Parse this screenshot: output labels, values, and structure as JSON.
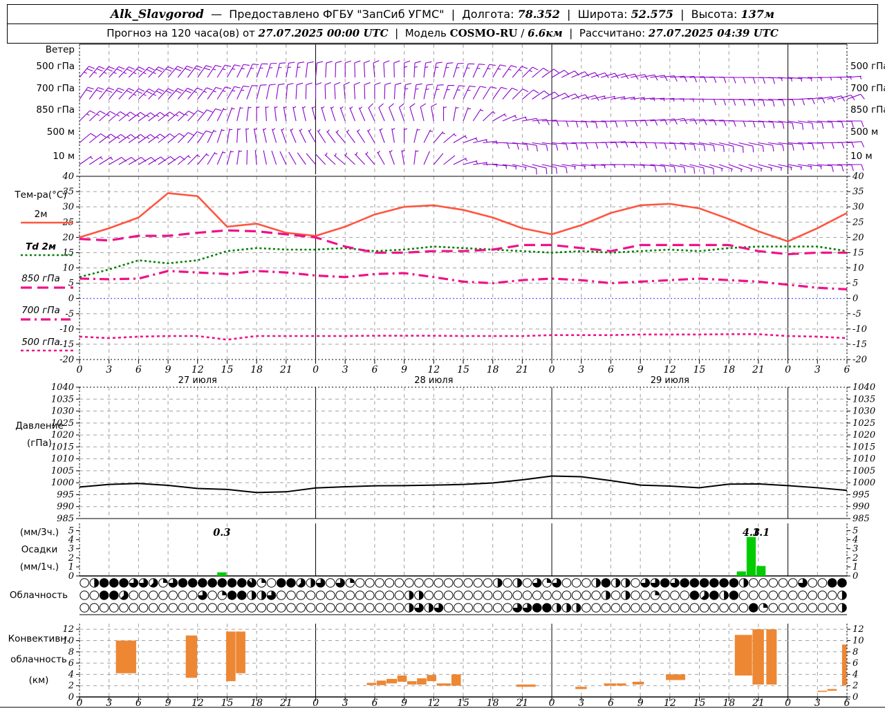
{
  "header": {
    "station": "Alk_Slavgorod",
    "dash": "—",
    "provider": "Предоставлено ФГБУ \"ЗапСиб УГМС\"",
    "sep": "|",
    "lon_label": "Долгота:",
    "lon": "78.352",
    "lat_label": "Широта:",
    "lat": "52.575",
    "alt_label": "Высота:",
    "alt": "137м",
    "forecast_label": "Прогноз на 120 часа(ов) от",
    "forecast_start": "27.07.2025 00:00 UTC",
    "model_label": "Модель",
    "model_name": "COSMO-RU",
    "model_slash": "/",
    "model_res": "6.6км",
    "calc_label": "Рассчитано:",
    "calc_time": "27.07.2025 04:39 UTC"
  },
  "labels": {
    "wind_title": "Ветер",
    "temp_title": "Тем-ра(°C)",
    "pressure_1": "Давление",
    "pressure_2": "(гПа)",
    "precip_1": "(мм/3ч.)",
    "precip_2": "Осадки",
    "precip_3": "(мм/1ч.)",
    "cloud_title": "Облачность",
    "conv_1": "Конвективн.",
    "conv_2": "облачность",
    "conv_3": "(км)"
  },
  "colors": {
    "barb": "#8800CC",
    "t2m": "#FF5540",
    "td2m": "#008000",
    "magenta": "#EE1289",
    "zero_line": "#4444FF",
    "pressure": "#000000",
    "precip": "#00CC00",
    "conv": "#ED8733",
    "grid": "#A0A0A0"
  },
  "chart_data": [
    {
      "type": "wind-barbs",
      "title": "Ветер",
      "levels": [
        "500 гПа",
        "700 гПа",
        "850 гПа",
        "500 м",
        "10 м"
      ],
      "hours_step": 3,
      "series": [
        {
          "name": "500 гПа",
          "dir": [
            40,
            42,
            45,
            40,
            35,
            30,
            20,
            10,
            5,
            0,
            -5,
            0,
            10,
            20,
            30,
            45,
            60,
            70,
            75,
            80,
            85,
            88,
            90,
            92,
            95,
            90,
            85
          ],
          "spd": [
            25,
            25,
            25,
            22,
            20,
            18,
            15,
            15,
            12,
            12,
            12,
            15,
            18,
            18,
            15,
            15,
            12,
            10,
            10,
            10,
            10,
            12,
            12,
            10,
            8,
            8,
            8
          ]
        },
        {
          "name": "700 гПа",
          "dir": [
            35,
            40,
            45,
            42,
            38,
            30,
            15,
            5,
            0,
            -5,
            0,
            5,
            15,
            25,
            35,
            50,
            65,
            75,
            80,
            85,
            88,
            90,
            92,
            95,
            90,
            80,
            70
          ],
          "spd": [
            20,
            22,
            25,
            22,
            18,
            15,
            12,
            10,
            10,
            10,
            12,
            15,
            15,
            15,
            12,
            12,
            10,
            10,
            8,
            8,
            8,
            10,
            10,
            10,
            10,
            12,
            12
          ]
        },
        {
          "name": "850 гПа",
          "dir": [
            45,
            50,
            55,
            50,
            40,
            20,
            0,
            -10,
            -15,
            -20,
            -25,
            -20,
            -10,
            20,
            60,
            80,
            90,
            95,
            90,
            85,
            80,
            85,
            90,
            95,
            100,
            95,
            90
          ],
          "spd": [
            15,
            18,
            18,
            15,
            12,
            8,
            5,
            5,
            5,
            8,
            10,
            12,
            10,
            8,
            8,
            10,
            12,
            12,
            10,
            10,
            10,
            12,
            12,
            10,
            10,
            12,
            12
          ]
        },
        {
          "name": "500 м",
          "dir": [
            50,
            55,
            55,
            50,
            35,
            10,
            -10,
            -20,
            -30,
            -40,
            -30,
            0,
            40,
            70,
            90,
            100,
            95,
            90,
            85,
            90,
            95,
            100,
            105,
            100,
            95,
            90,
            85
          ],
          "spd": [
            12,
            15,
            15,
            12,
            10,
            5,
            5,
            5,
            5,
            8,
            8,
            8,
            5,
            8,
            10,
            12,
            12,
            10,
            10,
            12,
            12,
            12,
            10,
            10,
            10,
            12,
            12
          ]
        },
        {
          "name": "10 м",
          "dir": [
            55,
            60,
            60,
            55,
            40,
            15,
            -5,
            -25,
            -40,
            -50,
            -40,
            -10,
            40,
            75,
            95,
            105,
            100,
            95,
            90,
            95,
            100,
            105,
            110,
            105,
            100,
            95,
            90
          ],
          "spd": [
            8,
            10,
            10,
            10,
            8,
            5,
            3,
            3,
            3,
            5,
            5,
            5,
            3,
            5,
            8,
            10,
            10,
            8,
            8,
            10,
            10,
            10,
            8,
            8,
            8,
            10,
            10
          ]
        }
      ]
    },
    {
      "type": "line",
      "title": "Тем-ра(°C)",
      "ylim": [
        -20,
        40
      ],
      "yticks": [
        40,
        35,
        30,
        25,
        20,
        15,
        10,
        5,
        0,
        -5,
        -10,
        -15,
        -20
      ],
      "hours_step": 3,
      "legend": [
        {
          "key": "t2m",
          "label": "2м"
        },
        {
          "key": "td2m",
          "label": "Td  2м"
        },
        {
          "key": "t850",
          "label": "850 гПа"
        },
        {
          "key": "t700",
          "label": "700 гПа"
        },
        {
          "key": "t500",
          "label": "500 гПа"
        }
      ],
      "series": [
        {
          "key": "t2m",
          "values": [
            20,
            23,
            26.5,
            34.5,
            33.5,
            23.5,
            24.5,
            21.5,
            20.5,
            23.5,
            27.5,
            30,
            30.5,
            29,
            26.5,
            23,
            21,
            24,
            28,
            30.5,
            31,
            29.5,
            26,
            22,
            18.7,
            23,
            28
          ]
        },
        {
          "key": "td2m",
          "values": [
            7,
            9.5,
            12.5,
            11.5,
            12.5,
            15.5,
            16.5,
            16,
            16,
            16.5,
            15.5,
            16,
            17,
            16.5,
            16,
            15.5,
            15,
            15.5,
            15,
            15.5,
            16,
            15.5,
            16.5,
            17,
            17,
            17,
            15.5
          ]
        },
        {
          "key": "t850",
          "values": [
            19.5,
            19,
            20.5,
            20.5,
            21.5,
            22.3,
            22,
            21,
            20,
            17,
            15,
            15,
            15.5,
            15.5,
            16,
            17.5,
            17.5,
            16.5,
            15.5,
            17.5,
            17.5,
            17.5,
            17.5,
            15.5,
            14.5,
            15,
            15
          ]
        },
        {
          "key": "t700",
          "values": [
            6.5,
            6.3,
            6.5,
            9,
            8.5,
            8,
            9,
            8.5,
            7.5,
            7,
            8,
            8.3,
            7,
            5.5,
            5,
            6,
            6.5,
            6,
            5,
            5.5,
            6,
            6.5,
            6,
            5.5,
            4.5,
            3.5,
            3
          ]
        },
        {
          "key": "t500",
          "values": [
            -12.5,
            -13,
            -12.5,
            -12.3,
            -12.3,
            -13.5,
            -12.3,
            -12.3,
            -12.3,
            -12.3,
            -12.2,
            -12.2,
            -12.2,
            -12.3,
            -12.3,
            -12.3,
            -12,
            -12,
            -12,
            -11.8,
            -11.8,
            -11.8,
            -11.7,
            -11.7,
            -12.3,
            -12.5,
            -13
          ]
        }
      ],
      "zero_line": 0
    },
    {
      "type": "line",
      "title": "Давление (гПа)",
      "ylim": [
        985,
        1040
      ],
      "yticks": [
        1040,
        1035,
        1030,
        1025,
        1020,
        1015,
        1010,
        1005,
        1000,
        995,
        990,
        985
      ],
      "hours_step": 3,
      "series": [
        {
          "key": "pressure",
          "values": [
            998.2,
            999.3,
            999.7,
            998.9,
            997.6,
            997.2,
            995.9,
            996.2,
            997.8,
            998.3,
            998.7,
            998.8,
            999,
            999.3,
            999.9,
            1001.2,
            1002.8,
            1002.5,
            1000.9,
            999,
            998.6,
            997.9,
            999.4,
            999.5,
            998.8,
            997.9,
            996.8
          ]
        }
      ]
    },
    {
      "type": "bar",
      "title": "Осадки (мм/3ч.) (мм/1ч.)",
      "ylim": [
        0,
        5.8
      ],
      "yticks": [
        5,
        4,
        3,
        2,
        1,
        0
      ],
      "bars": [
        {
          "h": 14,
          "v": 0.4,
          "label": "0.3"
        },
        {
          "h": 66.8,
          "v": 0.5,
          "label": ""
        },
        {
          "h": 67.8,
          "v": 4.3,
          "label": "4.3"
        },
        {
          "h": 68.8,
          "v": 1.1,
          "label": "1.1"
        }
      ]
    },
    {
      "type": "cloud-symbols",
      "title": "Облачность",
      "okta_scale": 8,
      "rows": [
        [
          0,
          4,
          8,
          8,
          8,
          6,
          6,
          5,
          2,
          6,
          8,
          8,
          8,
          8,
          8,
          8,
          8,
          7,
          2,
          0,
          8,
          8,
          5,
          4,
          6,
          0,
          6,
          2,
          0,
          0,
          0,
          0,
          0,
          0,
          0,
          0,
          0,
          0,
          0,
          0,
          0,
          0,
          4,
          0,
          4,
          0,
          6,
          2,
          6,
          0,
          0,
          0,
          4,
          8,
          4,
          4,
          0,
          6,
          6,
          8,
          6,
          8,
          8,
          8,
          8,
          8,
          8,
          4,
          0,
          0,
          0,
          0,
          0,
          6,
          0,
          0,
          8,
          8
        ],
        [
          0,
          0,
          8,
          8,
          5,
          0,
          0,
          0,
          0,
          0,
          0,
          0,
          6,
          0,
          2,
          8,
          8,
          4,
          4,
          6,
          0,
          0,
          0,
          0,
          0,
          0,
          0,
          0,
          0,
          0,
          0,
          0,
          0,
          4,
          4,
          0,
          0,
          0,
          0,
          0,
          0,
          0,
          0,
          0,
          0,
          0,
          0,
          0,
          0,
          0,
          0,
          0,
          0,
          4,
          0,
          4,
          0,
          0,
          2,
          0,
          0,
          0,
          8,
          5,
          8,
          4,
          8,
          0,
          0,
          0,
          0,
          0,
          0,
          0,
          0,
          0,
          0,
          4
        ],
        [
          0,
          0,
          0,
          0,
          0,
          0,
          0,
          0,
          0,
          0,
          0,
          0,
          0,
          0,
          0,
          0,
          0,
          0,
          0,
          0,
          0,
          0,
          0,
          0,
          0,
          0,
          0,
          0,
          0,
          0,
          0,
          0,
          0,
          4,
          6,
          4,
          6,
          0,
          0,
          0,
          0,
          0,
          0,
          0,
          6,
          6,
          8,
          8,
          4,
          4,
          4,
          0,
          0,
          0,
          0,
          0,
          0,
          0,
          0,
          0,
          0,
          0,
          0,
          0,
          0,
          0,
          0,
          0,
          8,
          2,
          0,
          0,
          0,
          0,
          0,
          0,
          0,
          4
        ]
      ]
    },
    {
      "type": "layer-bars",
      "title": "Конвективн. облачность (км)",
      "ylim": [
        0,
        13
      ],
      "yticks": [
        12,
        10,
        8,
        6,
        4,
        2,
        0
      ],
      "bars": [
        [
          3.7,
          5.8,
          4.2,
          10
        ],
        [
          10.8,
          12,
          3.4,
          10.9
        ],
        [
          14.9,
          15.9,
          2.8,
          11.6
        ],
        [
          15.9,
          16.9,
          4.2,
          11.6
        ],
        [
          29.2,
          30.2,
          2.1,
          2.5
        ],
        [
          30.2,
          31.2,
          2.1,
          2.9
        ],
        [
          31.2,
          32.3,
          2.4,
          3.2
        ],
        [
          32.3,
          33.3,
          2.7,
          3.8
        ],
        [
          33.3,
          34.3,
          2.2,
          2.8
        ],
        [
          34.3,
          35.3,
          2.2,
          3.3
        ],
        [
          35.3,
          36.3,
          2.8,
          3.9
        ],
        [
          36.3,
          37.8,
          2,
          2.4
        ],
        [
          37.8,
          38.8,
          2,
          4
        ],
        [
          44.4,
          46.4,
          1.8,
          2.2
        ],
        [
          50.4,
          51.6,
          1.4,
          1.8
        ],
        [
          53.3,
          54.6,
          2,
          2.4
        ],
        [
          54.6,
          55.6,
          2,
          2.4
        ],
        [
          56.2,
          57.4,
          2.2,
          2.7
        ],
        [
          59.6,
          61.6,
          3,
          4
        ],
        [
          66.6,
          68.4,
          3.8,
          11
        ],
        [
          68.4,
          69.6,
          2.2,
          12
        ],
        [
          69.8,
          70.9,
          2.2,
          12
        ],
        [
          75,
          76,
          0.9,
          1.1
        ],
        [
          76,
          77,
          1.1,
          1.4
        ],
        [
          77.5,
          78,
          2,
          9.3
        ]
      ]
    }
  ],
  "time_axis": {
    "hour_min": 0,
    "hour_max": 78,
    "tick_step": 3,
    "ticks": [
      0,
      3,
      6,
      9,
      12,
      15,
      18,
      21,
      24,
      27,
      30,
      33,
      36,
      39,
      42,
      45,
      48,
      51,
      54,
      57,
      60,
      63,
      66,
      69,
      72,
      75,
      78
    ],
    "day_lines": [
      24,
      48,
      72
    ],
    "dates": [
      {
        "hour": 12,
        "label": "27 июля"
      },
      {
        "hour": 36,
        "label": "28 июля"
      },
      {
        "hour": 60,
        "label": "29 июля"
      }
    ]
  }
}
